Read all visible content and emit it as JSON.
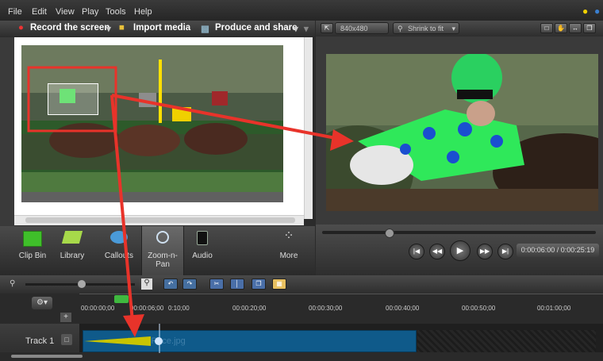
{
  "menubar": {
    "items": [
      "File",
      "Edit",
      "View",
      "Play",
      "Tools",
      "Help"
    ]
  },
  "toolbar": {
    "record_label": "Record the screen",
    "import_label": "Import media",
    "produce_label": "Produce and share"
  },
  "preview": {
    "dimensions": "840x480",
    "zoom": "Shrink to fit",
    "timecode": "0:00:06:00 / 0:00:25:19"
  },
  "tabs": [
    {
      "label": "Clip Bin"
    },
    {
      "label": "Library"
    },
    {
      "label": "Callouts"
    },
    {
      "label": "Zoom-n-\nPan"
    },
    {
      "label": "Audio"
    },
    {
      "label": "More"
    }
  ],
  "timeline": {
    "ruler": [
      "00:00:00;00",
      "00:00:06;00",
      "0:10;00",
      "00:00:20;00",
      "00:00:30;00",
      "00:00:40;00",
      "00:00:50;00",
      "00:01:00;00"
    ],
    "track_label": "Track 1",
    "clip_name": "HorseRace.jpg"
  },
  "colors": {
    "annotation_red": "#e8332a",
    "zoom_arrow": "#c9c400",
    "clip_blue": "#0f5a8a"
  }
}
